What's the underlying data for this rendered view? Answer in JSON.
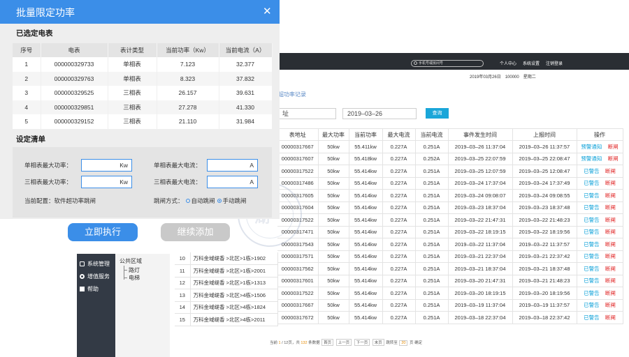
{
  "dialog": {
    "title": "批量限定功率",
    "selected_title": "已选定电表",
    "columns": [
      "序号",
      "电表",
      "表计类型",
      "当前功率（Kw）",
      "当前电流（A）"
    ],
    "rows": [
      [
        "1",
        "000000329733",
        "单相表",
        "7.123",
        "32.377"
      ],
      [
        "2",
        "000000329763",
        "单相表",
        "8.323",
        "37.832"
      ],
      [
        "3",
        "000000329525",
        "三相表",
        "26.157",
        "39.631"
      ],
      [
        "4",
        "000000329851",
        "三相表",
        "27.278",
        "41.330"
      ],
      [
        "5",
        "000000329152",
        "三相表",
        "21.110",
        "31.984"
      ]
    ],
    "settings_title": "设定清单",
    "single_power_label": "单相表最大功率：",
    "single_power_unit": "Kw",
    "single_current_label": "单相表最大电流：",
    "single_current_unit": "A",
    "three_power_label": "三相表最大功率：",
    "three_power_unit": "Kw",
    "three_current_label": "三相表最大电流：",
    "three_current_unit": "A",
    "current_config": "当前配置：软件超功率跳闸",
    "trip_mode_label": "跳闸方式：",
    "trip_auto": "自动跳闸",
    "trip_manual": "手动跳闸",
    "execute_button": "立即执行",
    "continue_button": "继续添加"
  },
  "background": {
    "search_placeholder": "手机号或房间号",
    "nav": [
      "个人中心",
      "系统设置",
      "注销登录"
    ],
    "date_line": "2019年03月26日　100000　星期二",
    "page_title": "超功率记录",
    "filter_left": "址",
    "filter_date": "2019–03–26",
    "query_button": "查询",
    "columns": [
      "表地址",
      "最大功率",
      "当前功率",
      "最大电流",
      "当前电流",
      "事件发生时间",
      "上报时间",
      "操作"
    ],
    "rows": [
      [
        "00000317667",
        "50kw",
        "55.411kw",
        "0.227A",
        "0.251A",
        "2019–03–26 11:37:04",
        "2019–03–26 11:37:57",
        "预警通知",
        "断闸"
      ],
      [
        "00000317607",
        "50kw",
        "55.418kw",
        "0.227A",
        "0.252A",
        "2019–03–25 22:07:59",
        "2019–03–25 22:08:47",
        "预警通知",
        "断闸"
      ],
      [
        "00000317522",
        "50kw",
        "55.414kw",
        "0.227A",
        "0.251A",
        "2019–03–25 12:07:59",
        "2019–03–25 12:08:47",
        "已警告",
        "断闸"
      ],
      [
        "00000317486",
        "50kw",
        "55.414kw",
        "0.227A",
        "0.251A",
        "2019–03–24 17:37:04",
        "2019–03–24 17:37:49",
        "已警告",
        "断闸"
      ],
      [
        "00000317605",
        "50kw",
        "55.414kw",
        "0.227A",
        "0.251A",
        "2019–03–24 09:08:07",
        "2019–03–24 09:08:55",
        "已警告",
        "断闸"
      ],
      [
        "00000317604",
        "50kw",
        "55.414kw",
        "0.227A",
        "0.251A",
        "2019–03–23 18:37:04",
        "2019–03–23 18:37:48",
        "已警告",
        "断闸"
      ],
      [
        "00000317522",
        "50kw",
        "55.414kw",
        "0.227A",
        "0.251A",
        "2019–03–22 21:47:31",
        "2019–03–22 21:48:23",
        "已警告",
        "断闸"
      ],
      [
        "00000317471",
        "50kw",
        "55.414kw",
        "0.227A",
        "0.251A",
        "2019–03–22 18:19:15",
        "2019–03–22 18:19:56",
        "已警告",
        "断闸"
      ],
      [
        "00000317543",
        "50kw",
        "55.414kw",
        "0.227A",
        "0.251A",
        "2019–03–22 11:37:04",
        "2019–03–22 11:37:57",
        "已警告",
        "断闸"
      ],
      [
        "00000317571",
        "50kw",
        "55.414kw",
        "0.227A",
        "0.251A",
        "2019–03–21 22:37:04",
        "2019–03–21 22:37:42",
        "已警告",
        "断闸"
      ],
      [
        "00000317562",
        "50kw",
        "55.414kw",
        "0.227A",
        "0.251A",
        "2019–03–21 18:37:04",
        "2019–03–21 18:37:48",
        "已警告",
        "断闸"
      ],
      [
        "00000317601",
        "50kw",
        "55.414kw",
        "0.227A",
        "0.251A",
        "2019–03–20 21:47:31",
        "2019–03–21 21:48:23",
        "已警告",
        "断闸"
      ],
      [
        "00000317522",
        "50kw",
        "55.414kw",
        "0.227A",
        "0.251A",
        "2019–03–20 18:19:15",
        "2019–03–20 18:19:56",
        "已警告",
        "断闸"
      ],
      [
        "00000317667",
        "50kw",
        "55.414kw",
        "0.227A",
        "0.251A",
        "2019–03–19 11:37:04",
        "2019–03–19 11:37:57",
        "已警告",
        "断闸"
      ],
      [
        "00000317672",
        "50kw",
        "55.414kw",
        "0.227A",
        "0.251A",
        "2019–03–18 22:37:04",
        "2019–03–18 22:37:42",
        "已警告",
        "断闸"
      ]
    ],
    "left_rows": [
      [
        "10",
        "万科金域缇香 >北区>1栋>1902"
      ],
      [
        "11",
        "万科金域缇香 >北区>1栋>2001"
      ],
      [
        "12",
        "万科金域缇香 >北区>1栋>1313"
      ],
      [
        "13",
        "万科金域缇香 >北区>4栋>1506"
      ],
      [
        "14",
        "万科金域缇香 >北区>4栋>1824"
      ],
      [
        "15",
        "万科金域缇香 >北区>4栋>2011"
      ]
    ],
    "sidebar": [
      "系统管理",
      "增值服务",
      "帮助"
    ],
    "tree": {
      "root": "公共区域",
      "children": [
        "路灯",
        "电梯"
      ]
    },
    "watermark": "湖",
    "pager": {
      "prefix": "当前",
      "current": "1",
      "sep": "/ 12页，共",
      "total": "132",
      "suffix": "条数据",
      "first": "首页",
      "prev": "上一页",
      "next": "下一页",
      "last": "末页",
      "goto": "跳转至",
      "goto_value": "20",
      "page_unit": "页",
      "confirm": "确定"
    }
  },
  "colors": {
    "primary": "#3b8ee8",
    "topbar": "#2a2e33",
    "warn_link": "#0aa0d8",
    "cut_link": "#e02020",
    "sidebar": "#333a45"
  }
}
